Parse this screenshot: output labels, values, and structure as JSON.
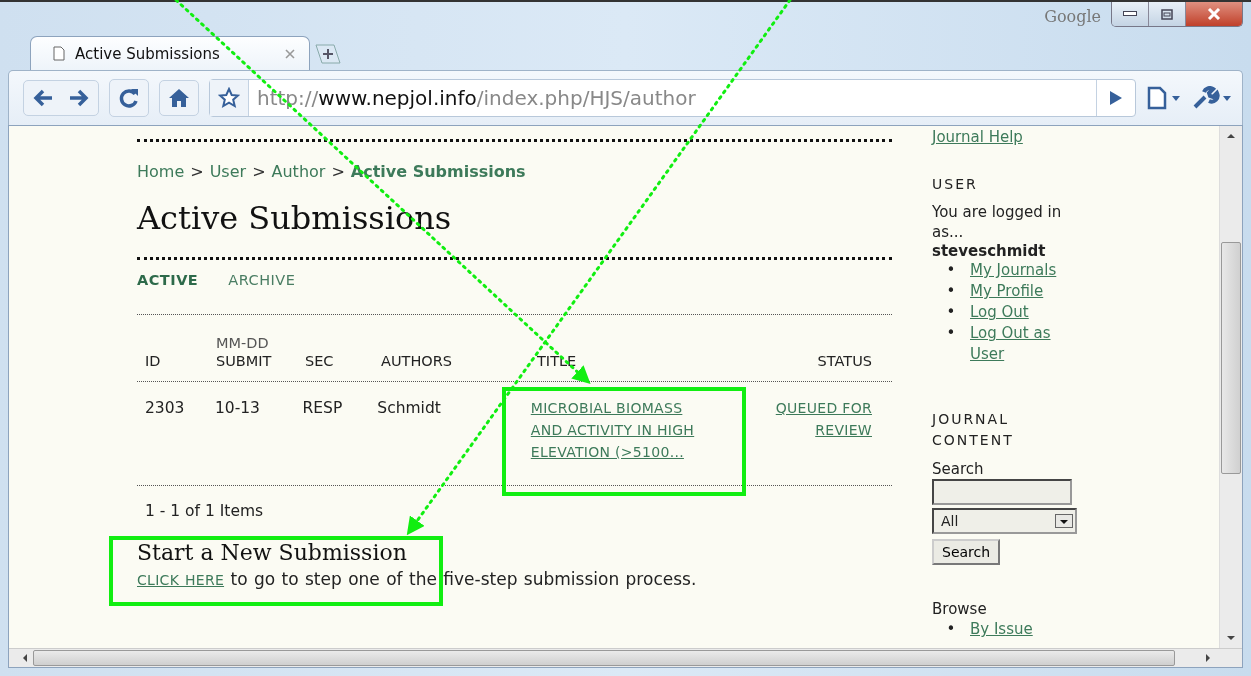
{
  "browser": {
    "brand": "Google",
    "tab_title": "Active Submissions",
    "url": {
      "scheme": "http://",
      "host": "www.nepjol.info",
      "path": "/index.php/HJS/author"
    }
  },
  "breadcrumb": [
    {
      "label": "Home",
      "current": false
    },
    {
      "label": "User",
      "current": false
    },
    {
      "label": "Author",
      "current": false
    },
    {
      "label": "Active Submissions",
      "current": true
    }
  ],
  "breadcrumb_separator": ">",
  "page_title": "Active Submissions",
  "tabs": [
    {
      "label": "ACTIVE",
      "selected": true
    },
    {
      "label": "ARCHIVE",
      "selected": false
    }
  ],
  "table": {
    "columns": [
      {
        "label": "ID"
      },
      {
        "over": "MM-DD",
        "label": "SUBMIT"
      },
      {
        "label": "SEC"
      },
      {
        "label": "AUTHORS"
      },
      {
        "label": "TITLE"
      },
      {
        "label": "STATUS"
      }
    ],
    "rows": [
      {
        "id": "2303",
        "submit": "10-13",
        "sec": "RESP",
        "authors": "Schmidt",
        "title": "MICROBIAL BIOMASS AND ACTIVITY IN HIGH ELEVATION (>5100...",
        "status": "QUEUED FOR REVIEW"
      }
    ]
  },
  "pager": "1 - 1 of 1 Items",
  "new_submission": {
    "heading": "Start a New Submission",
    "link": "CLICK HERE",
    "text": " to go to step one of the five-step submission process."
  },
  "sidebar": {
    "help_link": "Journal Help",
    "bullet": "•",
    "user": {
      "heading": "USER",
      "text": "You are logged in as...",
      "username": "steveschmidt",
      "links": [
        "My Journals",
        "My Profile",
        "Log Out",
        "Log Out as User"
      ]
    },
    "content": {
      "heading": "JOURNAL CONTENT",
      "search_label": "Search",
      "scope": "All",
      "search_button": "Search",
      "browse_label": "Browse",
      "browse_links": [
        "By Issue"
      ]
    }
  }
}
